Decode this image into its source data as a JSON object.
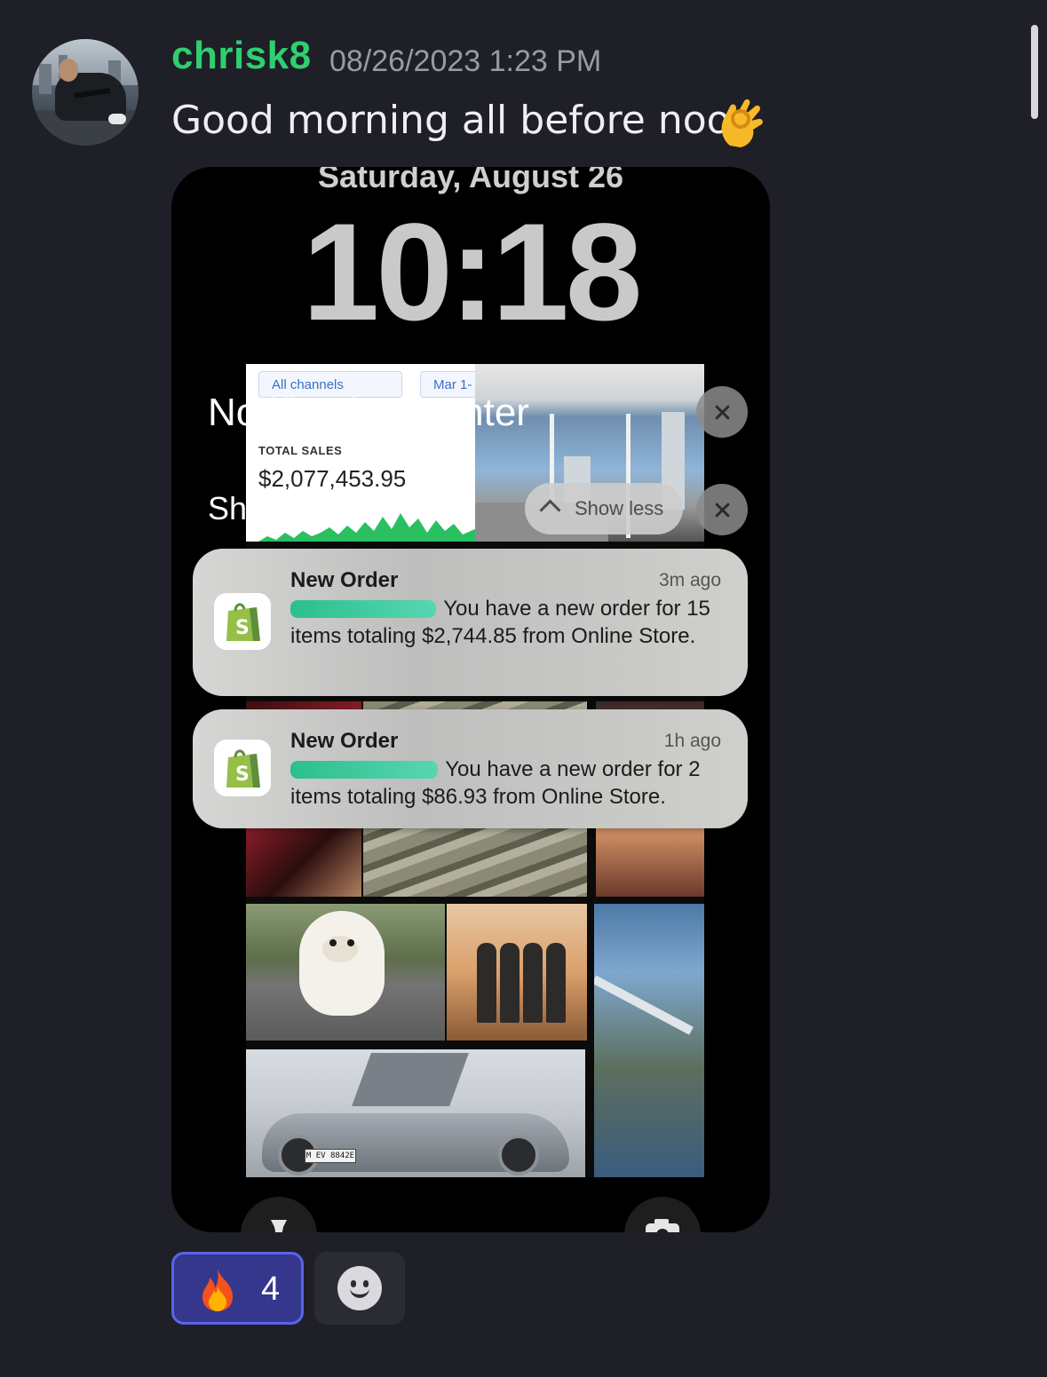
{
  "message": {
    "author": "chrisk8",
    "timestamp": "08/26/2023 1:23 PM",
    "text": "Good morning all before noon",
    "emoji": "ok-hand"
  },
  "attachment": {
    "lockscreen": {
      "date": "Saturday, August 26",
      "time": "10:18",
      "notification_center_title": "Notification Center",
      "app_group_label": "Shopify",
      "show_less_label": "Show less"
    },
    "dashboard": {
      "filter_channels": "All channels",
      "filter_date": "Mar 1-",
      "total_sales_label": "TOTAL SALES",
      "total_sales_value": "$2,077,453.95"
    },
    "notifications": [
      {
        "title": "New Order",
        "age": "3m ago",
        "body": "You have a new order for 15 items totaling $2,744.85 from Online Store."
      },
      {
        "title": "New Order",
        "age": "1h ago",
        "body": "You have a new order for 2 items totaling $86.93 from Online Store."
      }
    ],
    "car_plate": "M EV 8842E"
  },
  "reactions": [
    {
      "emoji": "fire",
      "count": "4",
      "active": true
    }
  ],
  "colors": {
    "background": "#1f1f28",
    "username": "#2fcf6f",
    "reaction_active_bg": "#35378c",
    "reaction_active_border": "#5b63e8"
  }
}
